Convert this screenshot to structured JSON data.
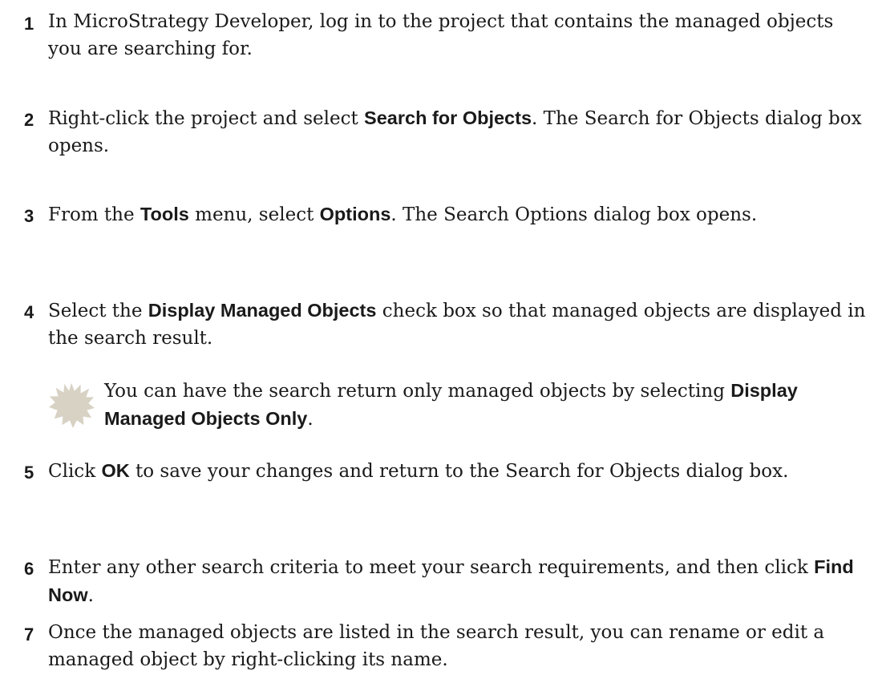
{
  "steps": [
    {
      "number": "1",
      "parts": [
        {
          "text": "In MicroStrategy Developer, log in to the project that contains the managed objects you are searching for.",
          "bold": false
        }
      ]
    },
    {
      "number": "2",
      "parts": [
        {
          "text": "Right-click the project and select ",
          "bold": false
        },
        {
          "text": "Search for Objects",
          "bold": true
        },
        {
          "text": ". The Search for Objects dialog box opens.",
          "bold": false
        }
      ]
    },
    {
      "number": "3",
      "parts": [
        {
          "text": "From the ",
          "bold": false
        },
        {
          "text": "Tools",
          "bold": true
        },
        {
          "text": " menu, select ",
          "bold": false
        },
        {
          "text": "Options",
          "bold": true
        },
        {
          "text": ". The Search Options dialog box opens.",
          "bold": false
        }
      ]
    },
    {
      "number": "4",
      "parts": [
        {
          "text": "Select the ",
          "bold": false
        },
        {
          "text": "Display Managed Objects",
          "bold": true
        },
        {
          "text": " check box so that managed objects are displayed in the search result.",
          "bold": false
        }
      ]
    },
    {
      "number": "5",
      "parts": [
        {
          "text": "Click ",
          "bold": false
        },
        {
          "text": "OK",
          "bold": true
        },
        {
          "text": " to save your changes and return to the Search for Objects dialog box.",
          "bold": false
        }
      ]
    },
    {
      "number": "6",
      "parts": [
        {
          "text": "Enter any other search criteria to meet your search requirements, and then click ",
          "bold": false
        },
        {
          "text": "Find Now",
          "bold": true
        },
        {
          "text": ".",
          "bold": false
        }
      ]
    },
    {
      "number": "7",
      "parts": [
        {
          "text": "Once the managed objects are listed in the search result, you can rename or edit a managed object by right-clicking its name.",
          "bold": false
        }
      ]
    }
  ],
  "note": {
    "icon": "note-burst-icon",
    "icon_color": "#d8d2c4",
    "parts": [
      {
        "text": "You can have the search return only managed objects by selecting ",
        "bold": false
      },
      {
        "text": "Display Managed Objects Only",
        "bold": true
      },
      {
        "text": ".",
        "bold": false
      }
    ]
  }
}
